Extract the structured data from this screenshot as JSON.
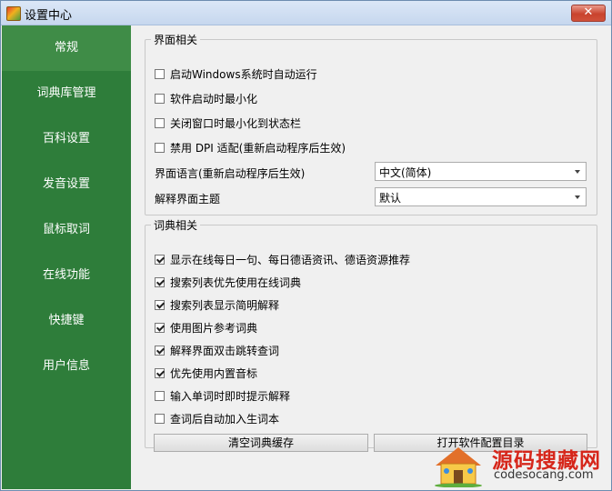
{
  "window": {
    "title": "设置中心",
    "close_glyph": "✕"
  },
  "sidebar": {
    "items": [
      {
        "label": "常规",
        "active": true
      },
      {
        "label": "词典库管理"
      },
      {
        "label": "百科设置"
      },
      {
        "label": "发音设置"
      },
      {
        "label": "鼠标取词"
      },
      {
        "label": "在线功能"
      },
      {
        "label": "快捷键"
      },
      {
        "label": "用户信息"
      }
    ]
  },
  "ui_group": {
    "legend": "界面相关",
    "checkboxes": [
      {
        "label": "启动Windows系统时自动运行",
        "checked": false
      },
      {
        "label": "软件启动时最小化",
        "checked": false
      },
      {
        "label": "关闭窗口时最小化到状态栏",
        "checked": false
      },
      {
        "label": "禁用 DPI 适配(重新启动程序后生效)",
        "checked": false
      }
    ],
    "language_label": "界面语言(重新启动程序后生效)",
    "language_value": "中文(简体)",
    "theme_label": "解释界面主题",
    "theme_value": "默认"
  },
  "dict_group": {
    "legend": "词典相关",
    "checkboxes": [
      {
        "label": "显示在线每日一句、每日德语资讯、德语资源推荐",
        "checked": true
      },
      {
        "label": "搜索列表优先使用在线词典",
        "checked": true
      },
      {
        "label": "搜索列表显示简明解释",
        "checked": true
      },
      {
        "label": "使用图片参考词典",
        "checked": true
      },
      {
        "label": "解释界面双击跳转查词",
        "checked": true
      },
      {
        "label": "优先使用内置音标",
        "checked": true
      },
      {
        "label": "输入单词时即时提示解释",
        "checked": false
      },
      {
        "label": "查词后自动加入生词本",
        "checked": false
      }
    ],
    "clear_cache_button": "清空词典缓存",
    "open_config_button": "打开软件配置目录"
  },
  "watermark": {
    "title": "源码搜藏网",
    "url": "codesocang.com"
  },
  "colors": {
    "sidebar": "#2e7d3a",
    "sidebar_active": "#3f8c47",
    "watermark_red": "#d6261a"
  }
}
